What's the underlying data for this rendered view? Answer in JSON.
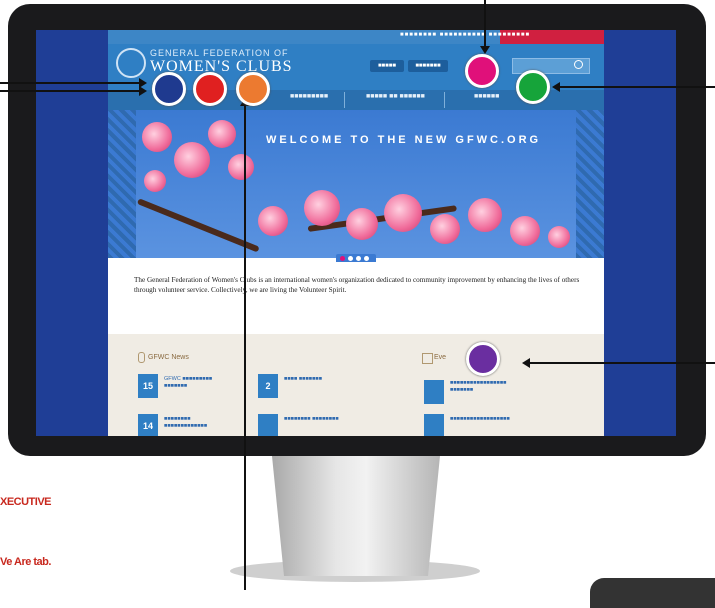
{
  "site": {
    "topbar_links": "■■■■■■■■ ■■■■■■■■■■ ■■■■■■■■■",
    "logo_line1": "GENERAL FEDERATION OF",
    "logo_line2": "WOMEN'S CLUBS",
    "header_buttons": [
      "■■■■■",
      "■■■■■■■"
    ],
    "nav_items": [
      "■■■■■■■■■",
      "■■■■■ ■■ ■■■■■■",
      "■■■■■■"
    ],
    "hero_title": "WELCOME TO THE NEW GFWC.ORG",
    "intro_text": "The General Federation of Women's Clubs is an international women's organization dedicated to community improvement by enhancing the lives of others through volunteer service. Collectively, we are living the Volunteer Spirit.",
    "news_heading": "GFWC News",
    "events_heading": "Eve",
    "news_items": [
      {
        "day": "15",
        "text": "GFWC ■■■■■■■■■ ■■■■■■■"
      },
      {
        "day": "2",
        "text": "■■■■ ■■■■■■■"
      },
      {
        "day": "14",
        "text": "■■■■■■■■ ■■■■■■■■■■■■■"
      },
      {
        "day": "",
        "text": "■■■■■■■■ ■■■■■■■■"
      }
    ],
    "event_items": [
      {
        "day": "",
        "text": "■■■■■■■■■■■■■■■■■ ■■■■■■■"
      },
      {
        "day": "",
        "text": "■■■■■■■■■■■■■■■■■■"
      }
    ]
  },
  "markers": [
    {
      "name": "marker-navy",
      "color": "#1f3a8f"
    },
    {
      "name": "marker-red",
      "color": "#e02020"
    },
    {
      "name": "marker-orange",
      "color": "#ec7a30"
    },
    {
      "name": "marker-magenta",
      "color": "#e0107a"
    },
    {
      "name": "marker-green",
      "color": "#16a43a"
    },
    {
      "name": "marker-purple",
      "color": "#6a2ea0"
    }
  ],
  "captions": {
    "executive": "XECUTIVE",
    "we_are_tab": "Ve Are tab."
  }
}
